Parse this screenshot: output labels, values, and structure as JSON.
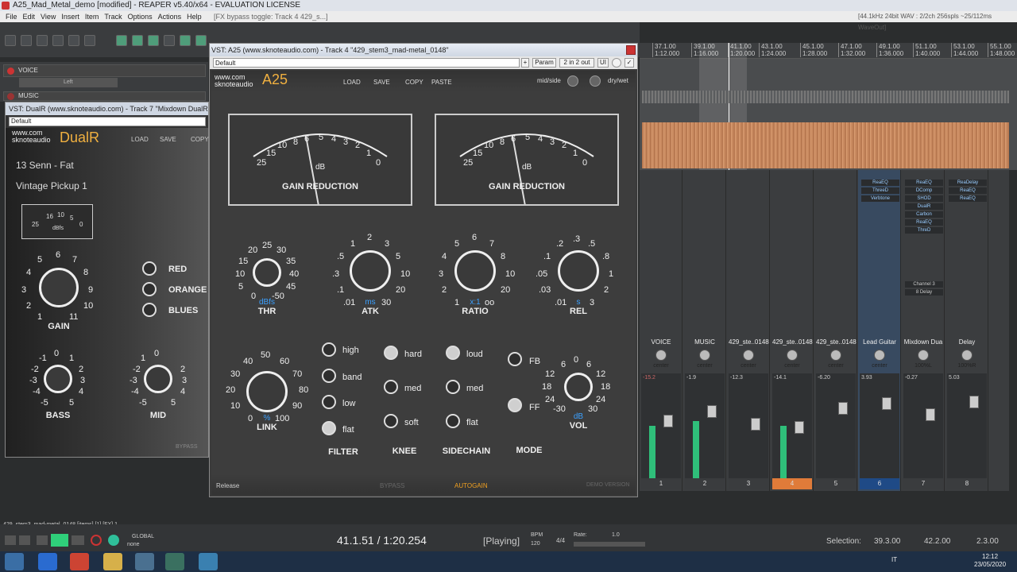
{
  "window": {
    "title": "A25_Mad_Metal_demo [modified] - REAPER v5.40/x64 - EVALUATION LICENSE"
  },
  "menu": [
    "File",
    "Edit",
    "View",
    "Insert",
    "Item",
    "Track",
    "Options",
    "Actions",
    "Help"
  ],
  "menu_status": "[FX bypass toggle: Track 4 429_s...]",
  "audio_format": "[44.1kHz 24bit WAV : 2/2ch 256spls ~25/112ms WaveOut]",
  "ruler": [
    {
      "bar": "37.1.00",
      "time": "1:12.000"
    },
    {
      "bar": "39.1.00",
      "time": "1:16.000"
    },
    {
      "bar": "41.1.00",
      "time": "1:20.000"
    },
    {
      "bar": "43.1.00",
      "time": "1:24.000"
    },
    {
      "bar": "45.1.00",
      "time": "1:28.000"
    },
    {
      "bar": "47.1.00",
      "time": "1:32.000"
    },
    {
      "bar": "49.1.00",
      "time": "1:36.000"
    },
    {
      "bar": "51.1.00",
      "time": "1:40.000"
    },
    {
      "bar": "53.1.00",
      "time": "1:44.000"
    },
    {
      "bar": "55.1.00",
      "time": "1:48.000"
    }
  ],
  "tracks_left": [
    {
      "name": "VOICE",
      "pan": "Left"
    },
    {
      "name": "MUSIC"
    }
  ],
  "plug_a": {
    "title": "VST: A25 (www.sknoteaudio.com) - Track 4 \"429_stem3_mad-metal_0148\"",
    "preset": "Default",
    "param_label": "Param",
    "io_label": "2 in 2 out",
    "ui_label": "UI",
    "brand": "www.com sknoteaudio",
    "name": "A25",
    "menu": [
      "LOAD",
      "SAVE",
      "COPY",
      "PASTE"
    ],
    "midside": "mid/side",
    "drywet": "dry/wet",
    "meter_scale": [
      "25",
      "15",
      "10",
      "8",
      "6",
      "5",
      "4",
      "3",
      "2",
      "1",
      "0"
    ],
    "meter_unit": "dB",
    "meter_label": "GAIN REDUCTION",
    "thr": {
      "label": "THR",
      "unit": "dBfs",
      "scale": [
        "20",
        "25",
        "30",
        "15",
        "35",
        "10",
        "40",
        "5",
        "45",
        "0",
        "-50"
      ]
    },
    "atk": {
      "label": "ATK",
      "unit": "ms",
      "scale": [
        "1",
        "2",
        "3",
        ".5",
        "5",
        ".3",
        "10",
        ".1",
        "20",
        ".01",
        "30"
      ]
    },
    "ratio": {
      "label": "RATIO",
      "unit": "x:1",
      "scale": [
        "5",
        "6",
        "7",
        "4",
        "8",
        "3",
        "10",
        "2",
        "20",
        "1",
        "oo"
      ]
    },
    "rel": {
      "label": "REL",
      "unit": "s",
      ".scale": [],
      "scale": [
        ".2",
        ".3",
        ".5",
        ".1",
        ".8",
        ".05",
        "1",
        ".03",
        "2",
        ".01",
        "3"
      ]
    },
    "link": {
      "label": "LINK",
      "unit": "%",
      "scale": [
        "40",
        "50",
        "60",
        "30",
        "70",
        "20",
        "80",
        "10",
        "90",
        "0",
        "100"
      ]
    },
    "vol": {
      "label": "VOL",
      "unit": "dB",
      "scale": [
        "6",
        "0",
        "6",
        "12",
        "12",
        "18",
        "18",
        "24",
        "24",
        "-30",
        "30"
      ]
    },
    "filter": {
      "label": "FILTER",
      "options": [
        "high",
        "band",
        "low",
        "flat"
      ],
      "active": "flat"
    },
    "knee": {
      "label": "KNEE",
      "options": [
        "hard",
        "med",
        "soft"
      ],
      "active": "hard"
    },
    "sidechain": {
      "label": "SIDECHAIN",
      "options": [
        "loud",
        "med",
        "flat"
      ],
      "active": "loud"
    },
    "mode": {
      "label": "MODE",
      "options": [
        "FB",
        "FF"
      ],
      "active": "FF"
    },
    "footer": {
      "release": "Release",
      "bypass": "BYPASS",
      "autogain": "AUTOGAIN",
      "demo": "DEMO VERSION"
    }
  },
  "plug_b": {
    "title": "VST: DualR (www.sknoteaudio.com) - Track 7 \"Mixdown DualR Clean\" ",
    "preset": "Default",
    "brand": "www.com sknoteaudio",
    "name": "DualR",
    "menu": [
      "LOAD",
      "SAVE",
      "COPY"
    ],
    "preset_name": "13 Senn - Fat",
    "pickup": "Vintage Pickup 1",
    "meter_scale": [
      "25",
      "16",
      "10",
      "5",
      "0"
    ],
    "meter_unit": "dBfs",
    "gain": {
      "label": "GAIN",
      "scale": [
        "6",
        "5",
        "7",
        "4",
        "8",
        "3",
        "9",
        "2",
        "10",
        "1",
        "11"
      ]
    },
    "bass": {
      "label": "BASS",
      "scale": [
        "0",
        "-1",
        "1",
        "-2",
        "2",
        "-3",
        "3",
        "-4",
        "4",
        "-5",
        "5"
      ]
    },
    "mid": {
      "label": "MID",
      "scale": [
        "0",
        "1",
        "-2",
        "2",
        "-3",
        "3",
        "-4",
        "4",
        "-5",
        "5"
      ]
    },
    "tones": [
      "RED",
      "ORANGE",
      "BLUES"
    ],
    "bypass": "BYPASS"
  },
  "mixer": {
    "fx": {
      "strip5": [
        "ReaEQ",
        "ThreeD",
        "Verbtone"
      ],
      "strip6": [
        "ReaEQ",
        "DComp",
        "SHOD",
        "DualR",
        "Carbon",
        "ReaEQ",
        "ThreD"
      ],
      "strip7": [
        "ReaDelay",
        "ReaEQ",
        "ReaEQ"
      ]
    },
    "channels": [
      {
        "name": "VOICE",
        "pan": "center",
        "num": "1",
        "peak": "-15.2",
        "level": 0.55
      },
      {
        "name": "MUSIC",
        "pan": "center",
        "num": "2",
        "peak": "-1.9",
        "level": 0.6
      },
      {
        "name": "429_ste..0148",
        "pan": "center",
        "num": "3",
        "peak": "-12.3",
        "level": 0.0
      },
      {
        "name": "429_ste..0148",
        "pan": "center",
        "num": "4",
        "peak": "-14.1",
        "level": 0.55
      },
      {
        "name": "429_ste..0148",
        "pan": "center",
        "num": "5",
        "peak": "-6.20",
        "level": 0.0
      },
      {
        "name": "Lead Guitar",
        "pan": "center",
        "num": "6",
        "peak": "3.93",
        "level": 0.0
      },
      {
        "name": "Mixdown Dua",
        "pan": "100%L",
        "num": "7",
        "peak": "-0.27",
        "level": 0.0
      },
      {
        "name": "Delay",
        "pan": "100%R",
        "num": "8",
        "peak": "5.03",
        "level": 0.0
      }
    ],
    "send": "Channel 3",
    "send_fx": "8 Delay"
  },
  "item_info": "429_stem3_mad-metal_0148 [items] [1] [FX] 1",
  "transport": {
    "position": "41.1.51 / 1:20.254",
    "state": "[Playing]",
    "bpm_label": "BPM",
    "bpm": "120",
    "sig": "4/4",
    "rate_label": "Rate:",
    "rate": "1.0",
    "selection_label": "Selection:",
    "sel_start": "39.3.00",
    "sel_end": "42.2.00",
    "sel_len": "2.3.00",
    "global": "GLOBAL",
    "none": "none"
  },
  "taskbar": {
    "lang": "IT",
    "time": "12:12",
    "date": "23/05/2020"
  }
}
